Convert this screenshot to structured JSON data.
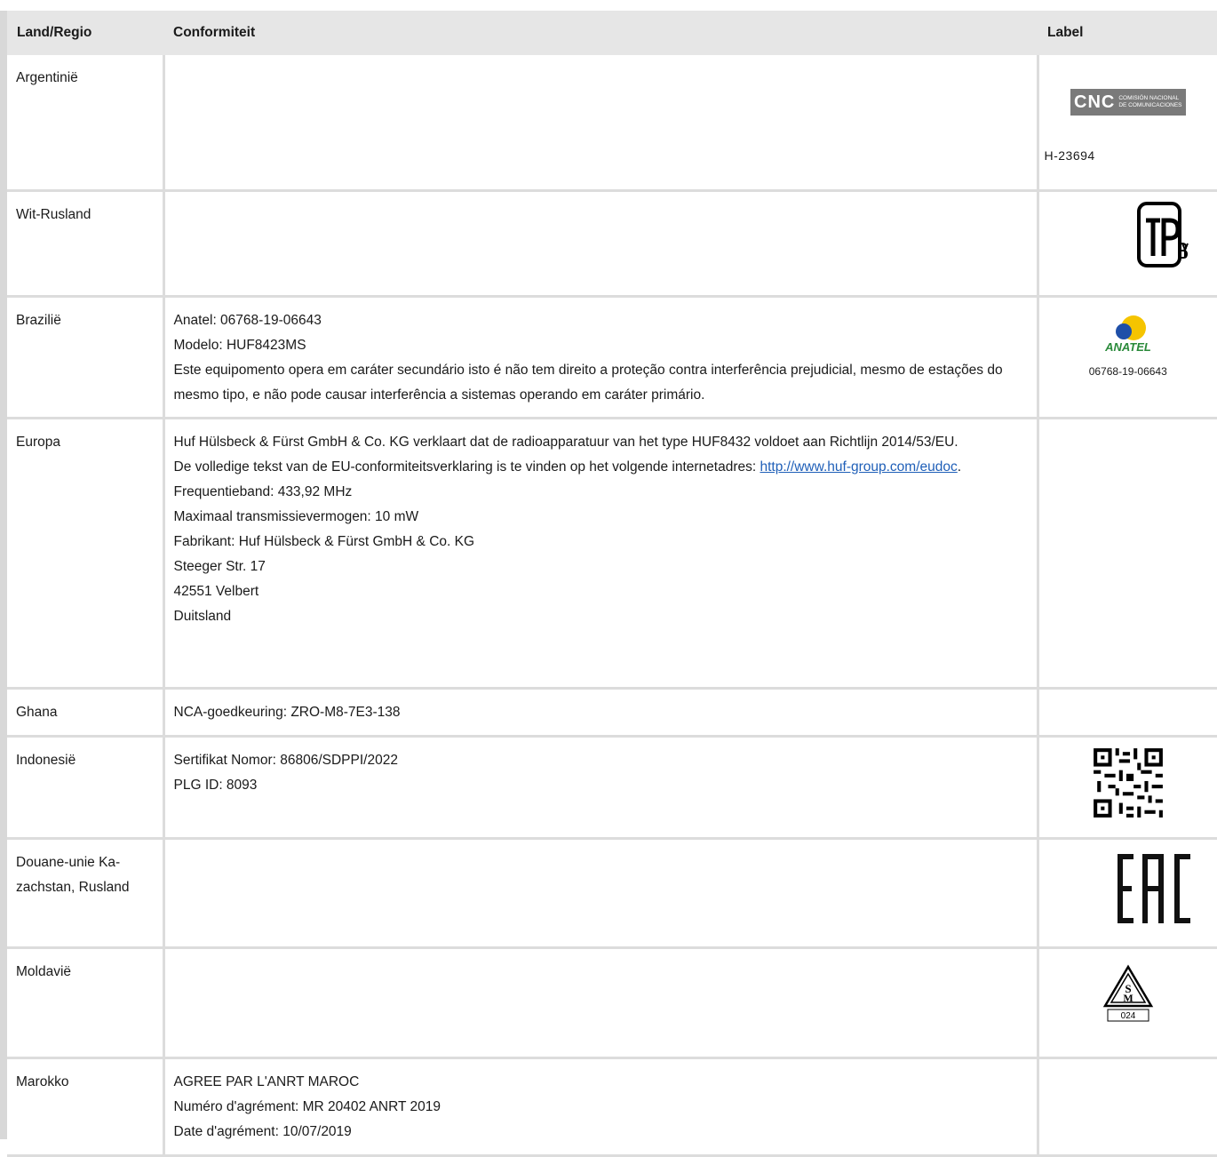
{
  "table": {
    "headers": [
      "Land/Regio",
      "Conformiteit",
      "Label"
    ],
    "rows": [
      {
        "country": "Argentinië",
        "conformity": [],
        "label_logo": "cnc-logo",
        "logo_text_big": "CNC",
        "logo_text_small_1": "COMISIÓN NACIONAL",
        "logo_text_small_2": "DE COMUNICACIONES",
        "label_text": "H-23694"
      },
      {
        "country": "Wit-Rusland",
        "conformity": [],
        "label_logo": "tp-by-logo"
      },
      {
        "country": "Brazilië",
        "conformity": [
          "Anatel: 06768-19-06643",
          "Modelo: HUF8423MS",
          "Este equipomento opera em caráter secundário isto é não tem direito a proteção contra interferência prejudicial, mesmo de estações do mesmo tipo, e não pode causar interferência a sistemas operando em caráter primário."
        ],
        "label_logo": "anatel-logo",
        "label_text": "06768-19-06643"
      },
      {
        "country": "Europa",
        "conformity_intro": "Huf Hülsbeck & Fürst GmbH & Co. KG verklaart dat de radioapparatuur van het type HUF8432 voldoet aan Richtlijn 2014/53/EU.",
        "conformity_link_text_before": "De volledige tekst van de EU-conformiteitsverklaring is te vinden op het volgende internetadres: ",
        "conformity_link": "http://www.huf-group.com/eudoc",
        "conformity_link_after": ".",
        "conformity": [
          "Frequentieband: 433,92 MHz",
          "Maximaal transmissievermogen: 10 mW",
          "Fabrikant: Huf Hülsbeck & Fürst GmbH & Co. KG",
          "Steeger Str. 17",
          "42551 Velbert",
          "Duitsland"
        ]
      },
      {
        "country": "Ghana",
        "conformity": [
          "NCA-goedkeuring: ZRO-M8-7E3-138"
        ]
      },
      {
        "country": "Indonesië",
        "conformity": [
          "Sertifikat Nomor: 86806/SDPPI/2022",
          "PLG ID: 8093"
        ],
        "label_logo": "qr-code"
      },
      {
        "country_line1": "Douane-unie Ka-",
        "country_line2": "zachstan, Rusland",
        "conformity": [],
        "label_logo": "eac-logo"
      },
      {
        "country": "Moldavië",
        "conformity": [],
        "label_logo": "sm-logo",
        "label_text": "024"
      },
      {
        "country": "Marokko",
        "conformity": [
          "AGREE PAR L'ANRT MAROC",
          "Numéro d'agrément: MR 20402 ANRT 2019",
          "Date d'agrément: 10/07/2019"
        ]
      }
    ]
  },
  "colors": {
    "header_bg": "#e6e6e6",
    "border": "#dcdcdc",
    "link": "#1f5fb8",
    "cnc_bg": "#7a7a7a",
    "anatel_blue": "#1f4fa8",
    "anatel_yellow": "#f5c400",
    "anatel_green": "#2a8a3a"
  },
  "anatel_wordmark": "ANATEL"
}
